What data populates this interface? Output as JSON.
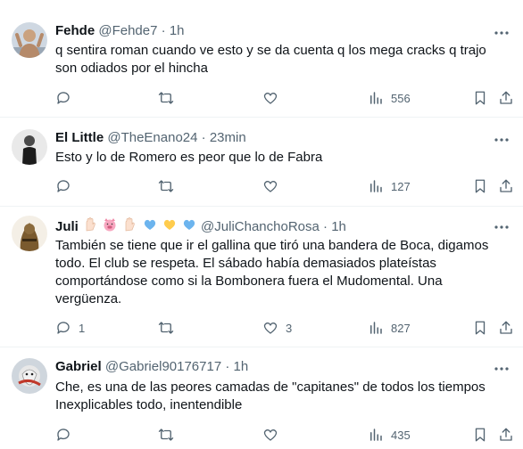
{
  "tweets": [
    {
      "name": "Fehde",
      "handle": "@Fehde7",
      "dot": "·",
      "time": "1h",
      "text": "q sentira roman cuando ve esto y se da cuenta q los mega cracks q trajo son odiados por el hincha",
      "replies": "",
      "retweets": "",
      "likes": "",
      "views": "556"
    },
    {
      "name": "El Little",
      "handle": "@TheEnano24",
      "dot": "·",
      "time": "23min",
      "text": "Esto y lo de Romero es peor que lo de Fabra",
      "replies": "",
      "retweets": "",
      "likes": "",
      "views": "127"
    },
    {
      "name": "Juli",
      "name_emojis": [
        "raised-hand-emoji",
        "pig-face-emoji",
        "raised-hand-emoji",
        "blue-heart-emoji",
        "yellow-heart-emoji",
        "blue-heart-emoji"
      ],
      "handle": "@JuliChanchoRosa",
      "dot": "·",
      "time": "1h",
      "text": "También se tiene que ir el gallina que tiró una bandera de Boca, digamos todo. El club se respeta. El sábado había demasiados plateístas comportándose como si la Bombonera fuera el Mudomental. Una vergüenza.",
      "replies": "1",
      "retweets": "",
      "likes": "3",
      "views": "827"
    },
    {
      "name": "Gabriel",
      "handle": "@Gabriel90176717",
      "dot": "·",
      "time": "1h",
      "text": "Che, es una de las peores camadas de \"capitanes\" de todos los tiempos\nInexplicables todo, inentendible",
      "replies": "",
      "retweets": "",
      "likes": "",
      "views": "435"
    }
  ],
  "colors": {
    "text": "#0f1419",
    "muted": "#536471",
    "divider": "#eff3f4"
  }
}
